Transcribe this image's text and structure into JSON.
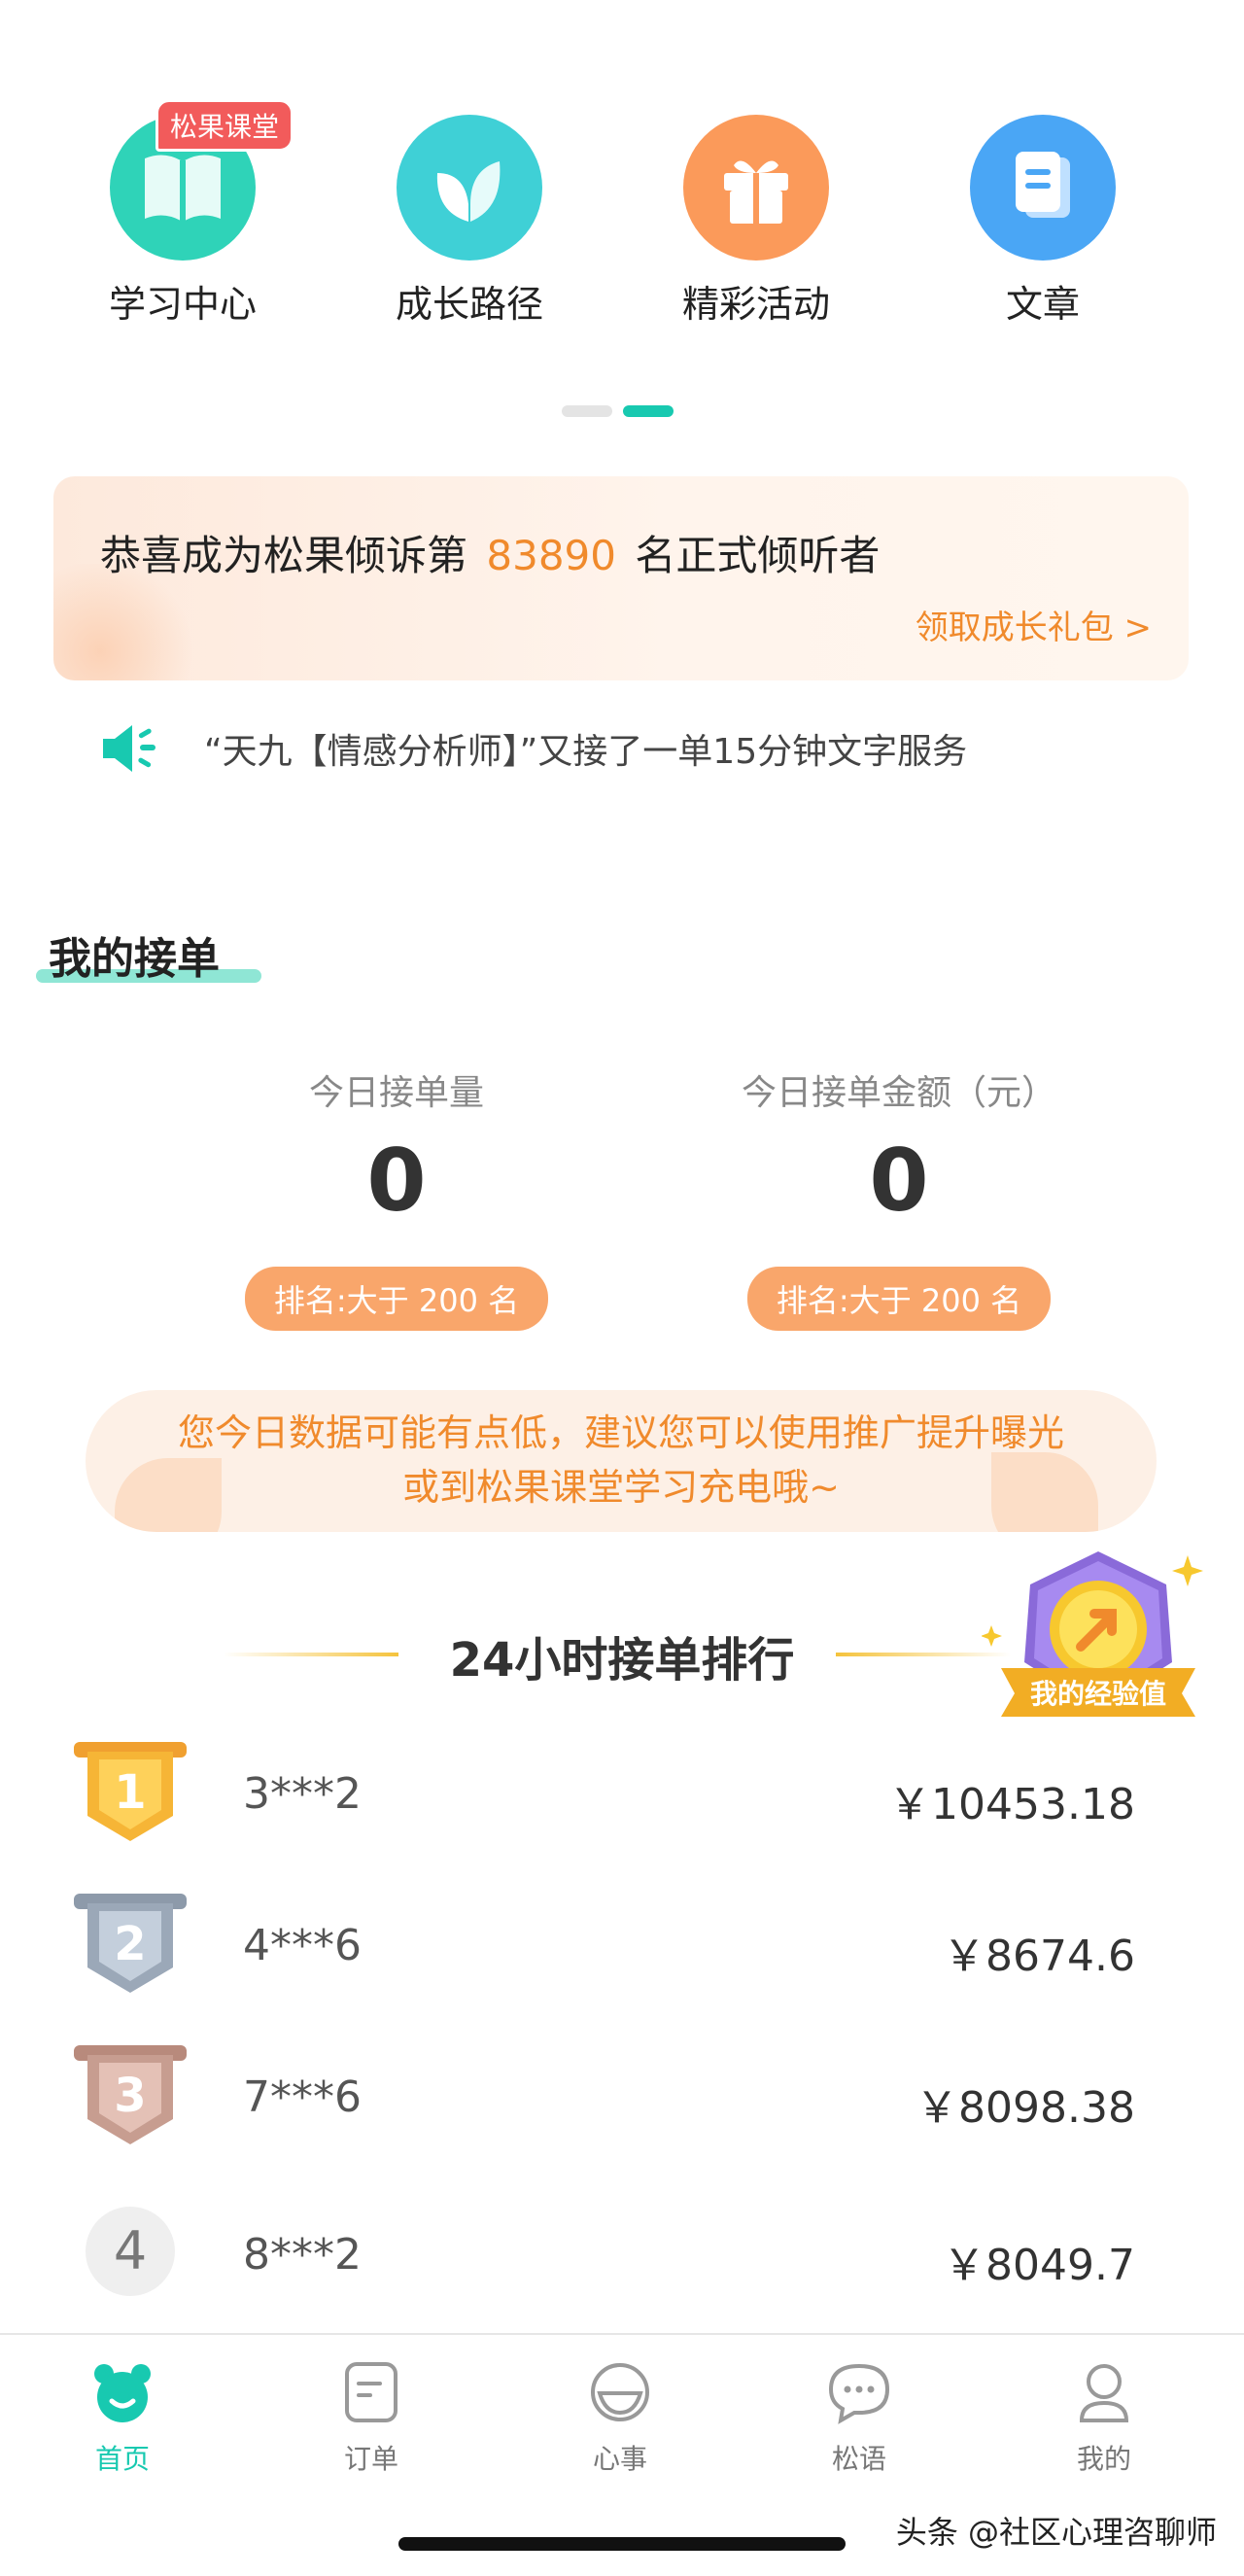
{
  "quick_access": [
    {
      "label": "学习中心",
      "badge": "松果课堂",
      "icon": "book-icon",
      "color": "#2fd3b8"
    },
    {
      "label": "成长路径",
      "icon": "leaf-icon",
      "color": "#3fd0d6"
    },
    {
      "label": "精彩活动",
      "icon": "gift-icon",
      "color": "#fb9a5a"
    },
    {
      "label": "文章",
      "icon": "document-icon",
      "color": "#4aa6f5"
    }
  ],
  "banner": {
    "prefix": "恭喜成为松果倾诉第",
    "number": "83890",
    "suffix": "名正式倾听者",
    "link": "领取成长礼包 >"
  },
  "notice": {
    "text": "“天九【情感分析师】”又接了一单15分钟文字服务"
  },
  "my_orders": {
    "title": "我的接单",
    "stats": [
      {
        "label": "今日接单量",
        "value": "0",
        "rank": "排名:大于 200 名"
      },
      {
        "label": "今日接单金额（元）",
        "value": "0",
        "rank": "排名:大于 200 名"
      }
    ],
    "tip_line1": "您今日数据可能有点低，建议您可以使用推广提升曝光",
    "tip_line2": "或到松果课堂学习充电哦~"
  },
  "ranking": {
    "title": "24小时接单排行",
    "experience_label": "我的经验值",
    "rows": [
      {
        "rank": "1",
        "name": "3***2",
        "amount": "￥10453.18"
      },
      {
        "rank": "2",
        "name": "4***6",
        "amount": "￥8674.6"
      },
      {
        "rank": "3",
        "name": "7***6",
        "amount": "￥8098.38"
      },
      {
        "rank": "4",
        "name": "8***2",
        "amount": "￥8049.7"
      }
    ]
  },
  "tabbar": [
    {
      "label": "首页",
      "icon": "home-bear-icon",
      "active": true
    },
    {
      "label": "订单",
      "icon": "order-icon",
      "active": false
    },
    {
      "label": "心事",
      "icon": "smile-icon",
      "active": false
    },
    {
      "label": "松语",
      "icon": "chat-icon",
      "active": false
    },
    {
      "label": "我的",
      "icon": "profile-icon",
      "active": false
    }
  ],
  "watermark": "头条 @社区心理咨聊师",
  "colors": {
    "accent": "#18c9b0",
    "orange": "#f08a2c",
    "rank_badge": "#f9a66b"
  }
}
